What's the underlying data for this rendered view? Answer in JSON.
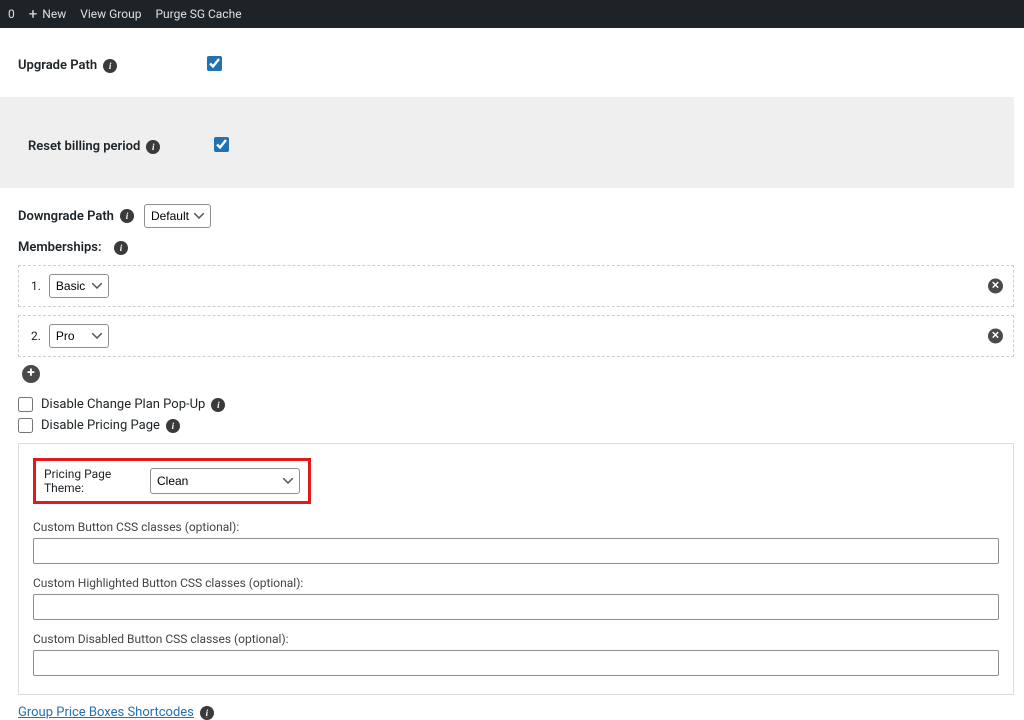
{
  "admin_bar": {
    "count": "0",
    "new_label": "New",
    "view_group_label": "View Group",
    "purge_label": "Purge SG Cache"
  },
  "upgrade_path": {
    "label": "Upgrade Path",
    "checked": true
  },
  "reset_billing": {
    "label": "Reset billing period",
    "checked": true
  },
  "downgrade_path": {
    "label": "Downgrade Path",
    "value": "Default",
    "options": [
      "Default"
    ]
  },
  "memberships": {
    "label": "Memberships:",
    "items": [
      {
        "idx": "1.",
        "value": "Basic",
        "options": [
          "Basic"
        ]
      },
      {
        "idx": "2.",
        "value": "Pro",
        "options": [
          "Pro"
        ]
      }
    ]
  },
  "chk_disable_popup": {
    "label": "Disable Change Plan Pop-Up",
    "checked": false
  },
  "chk_disable_pricing": {
    "label": "Disable Pricing Page",
    "checked": false
  },
  "pricing_theme": {
    "label": "Pricing Page Theme:",
    "value": "Clean",
    "options": [
      "Clean"
    ]
  },
  "css_fields": {
    "button": {
      "label": "Custom Button CSS classes (optional):",
      "value": ""
    },
    "highlighted": {
      "label": "Custom Highlighted Button CSS classes (optional):",
      "value": ""
    },
    "disabled": {
      "label": "Custom Disabled Button CSS classes (optional):",
      "value": ""
    }
  },
  "shortcodes_link": "Group Price Boxes Shortcodes"
}
